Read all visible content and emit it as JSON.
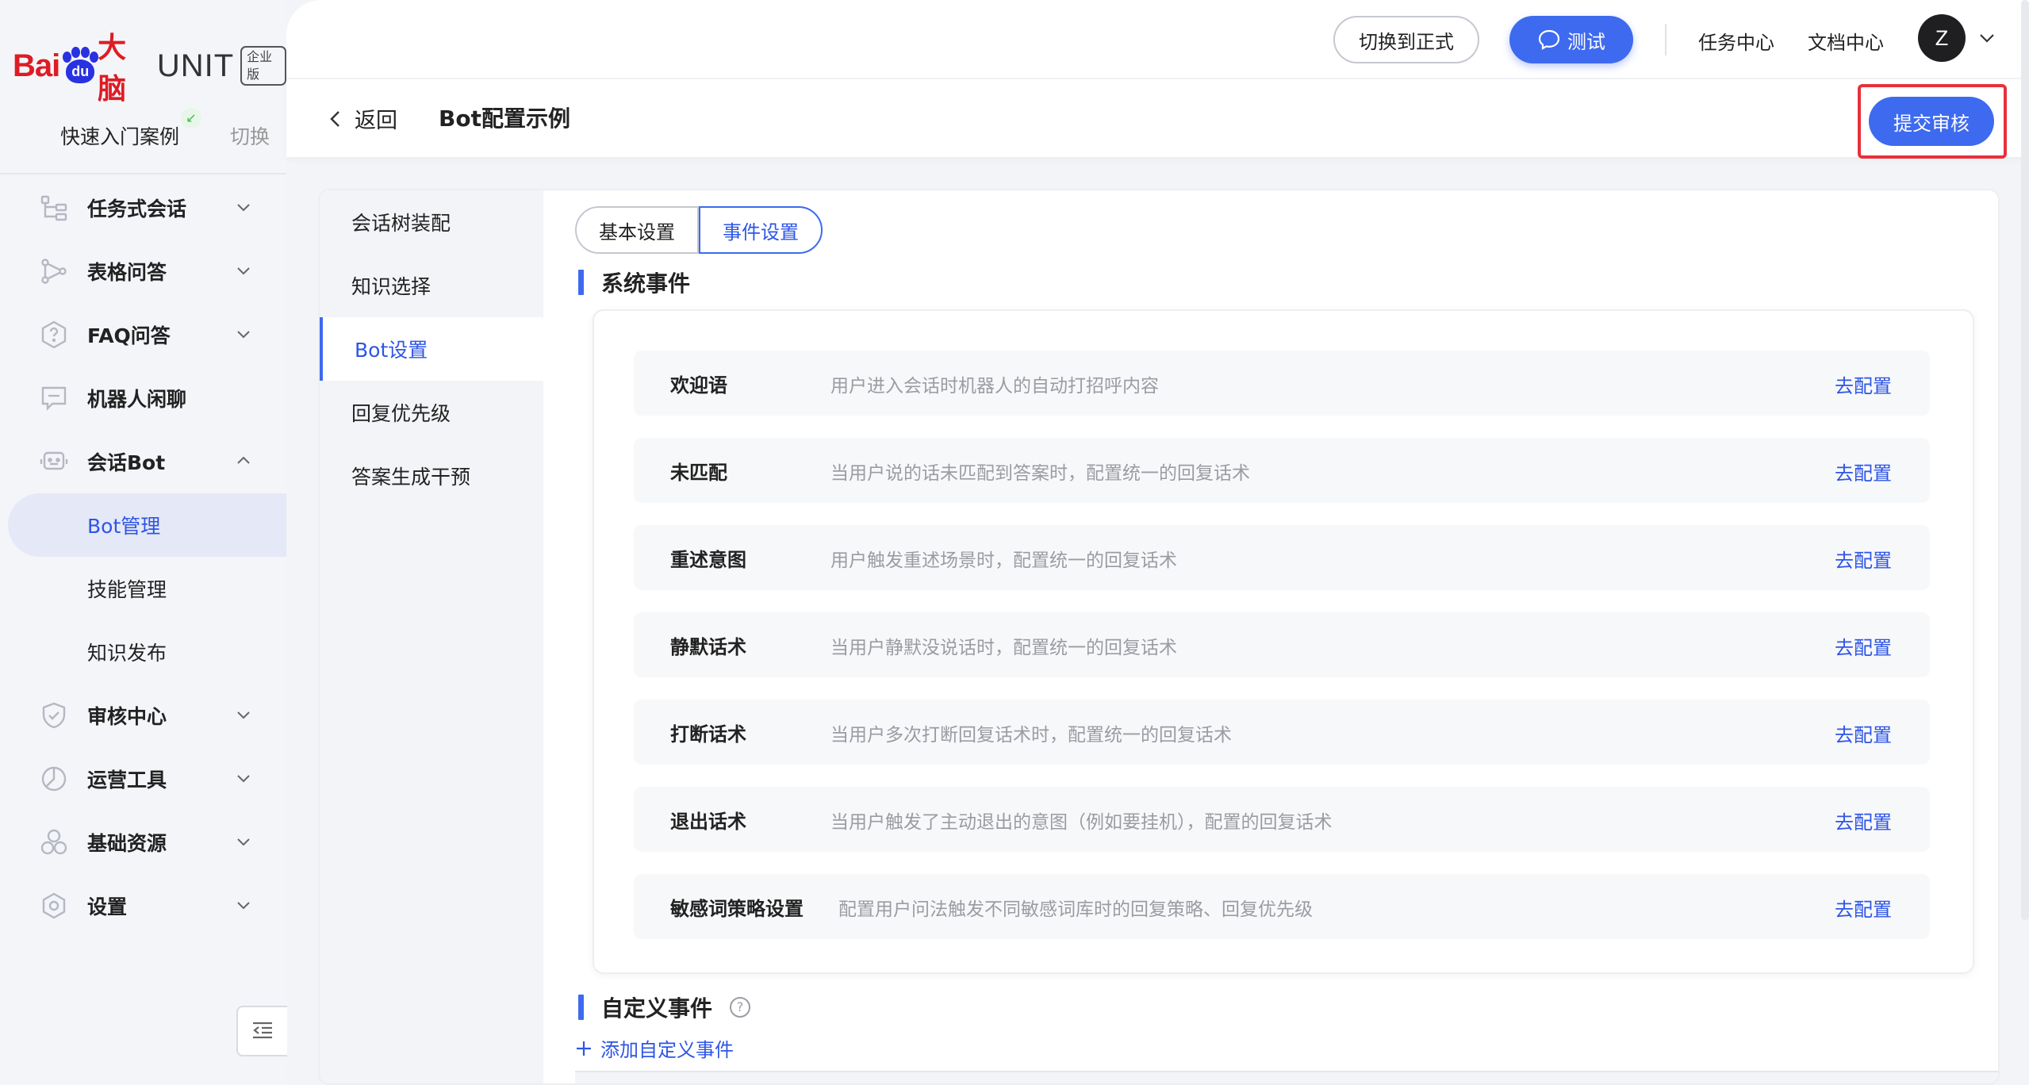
{
  "brand": {
    "bai": "Bai",
    "paw": "du",
    "danao": "大脑",
    "unit": "UNIT",
    "edition": "企业版"
  },
  "case": {
    "name": "快速入门案例",
    "switch_label": "切换"
  },
  "sidebar": {
    "items": [
      {
        "label": "任务式会话",
        "icon": "task-tree-icon"
      },
      {
        "label": "表格问答",
        "icon": "graph-icon"
      },
      {
        "label": "FAQ问答",
        "icon": "help-hexagon-icon"
      },
      {
        "label": "机器人闲聊",
        "icon": "chat-bubble-icon"
      },
      {
        "label": "会话Bot",
        "icon": "robot-icon"
      },
      {
        "label": "Bot管理"
      },
      {
        "label": "技能管理"
      },
      {
        "label": "知识发布"
      },
      {
        "label": "审核中心",
        "icon": "shield-check-icon"
      },
      {
        "label": "运营工具",
        "icon": "pie-chart-icon"
      },
      {
        "label": "基础资源",
        "icon": "cluster-icon"
      },
      {
        "label": "设置",
        "icon": "settings-hexagon-icon"
      }
    ]
  },
  "topbar": {
    "switch_prod_label": "切换到正式",
    "test_label": "测试",
    "task_center": "任务中心",
    "doc_center": "文档中心",
    "avatar_letter": "Z"
  },
  "titlebar": {
    "back_label": "返回",
    "title": "Bot配置示例",
    "submit_label": "提交审核"
  },
  "subnav": {
    "items": [
      "会话树装配",
      "知识选择",
      "Bot设置",
      "回复优先级",
      "答案生成干预"
    ],
    "active": "Bot设置"
  },
  "tabs": {
    "basic": "基本设置",
    "events": "事件设置"
  },
  "system_events": {
    "title": "系统事件",
    "rows": [
      {
        "name": "欢迎语",
        "desc": "用户进入会话时机器人的自动打招呼内容",
        "action": "去配置"
      },
      {
        "name": "未匹配",
        "desc": "当用户说的话未匹配到答案时，配置统一的回复话术",
        "action": "去配置"
      },
      {
        "name": "重述意图",
        "desc": "用户触发重述场景时，配置统一的回复话术",
        "action": "去配置"
      },
      {
        "name": "静默话术",
        "desc": "当用户静默没说话时，配置统一的回复话术",
        "action": "去配置"
      },
      {
        "name": "打断话术",
        "desc": "当用户多次打断回复话术时，配置统一的回复话术",
        "action": "去配置"
      },
      {
        "name": "退出话术",
        "desc": "当用户触发了主动退出的意图（例如要挂机），配置的回复话术",
        "action": "去配置"
      },
      {
        "name": "敏感词策略设置",
        "desc": "配置用户问法触发不同敏感词库时的回复策略、回复优先级",
        "action": "去配置"
      }
    ]
  },
  "custom_events": {
    "title": "自定义事件",
    "add_label": "添加自定义事件"
  },
  "colors": {
    "accent": "#3e6af0",
    "link": "#2e55e6",
    "highlight": "#e8303a"
  }
}
